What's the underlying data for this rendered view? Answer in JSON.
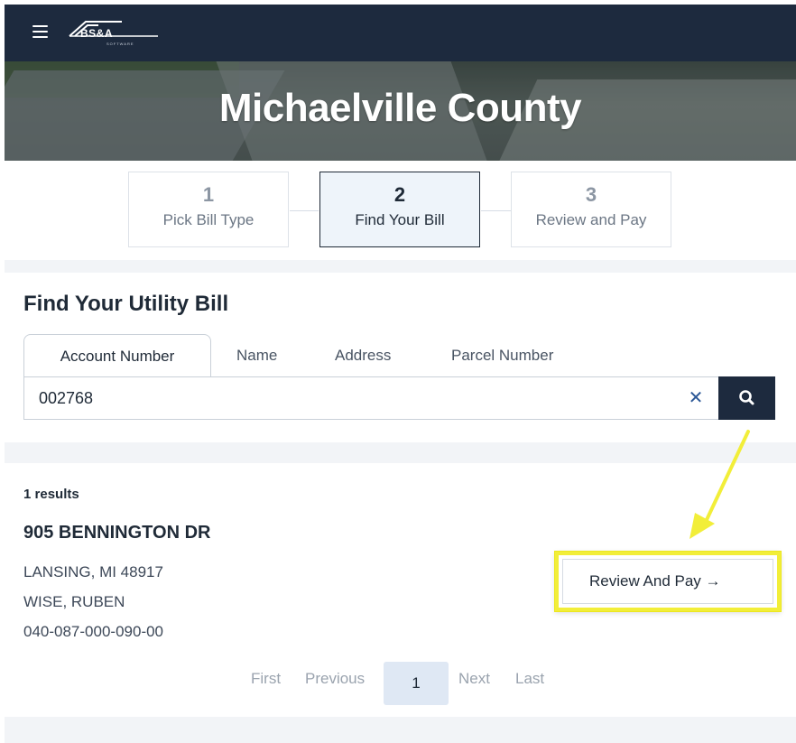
{
  "header": {
    "logo_text": "BS&A",
    "logo_subtext": "SOFTWARE",
    "menu_icon": "hamburger-menu-icon"
  },
  "hero": {
    "title": "Michaelville County"
  },
  "steps": [
    {
      "number": "1",
      "label": "Pick Bill Type"
    },
    {
      "number": "2",
      "label": "Find Your Bill"
    },
    {
      "number": "3",
      "label": "Review and Pay"
    }
  ],
  "search": {
    "heading": "Find Your Utility Bill",
    "tabs": [
      "Account Number",
      "Name",
      "Address",
      "Parcel Number"
    ],
    "active_tab": "Account Number",
    "value": "002768",
    "clear_icon": "close-icon",
    "search_icon": "search-icon"
  },
  "results": {
    "count_label": "1 results",
    "items": [
      {
        "address": "905 BENNINGTON DR",
        "city_line": "LANSING, MI 48917",
        "owner": "WISE, RUBEN",
        "parcel": "040-087-000-090-00",
        "action_label": "Review And Pay →"
      }
    ]
  },
  "pagination": {
    "first": "First",
    "previous": "Previous",
    "current": "1",
    "next": "Next",
    "last": "Last"
  },
  "colors": {
    "navy": "#1d2a3e",
    "highlight_yellow": "#f2ee39",
    "active_step_bg": "#eef4fa",
    "link_blue": "#2b5796"
  }
}
